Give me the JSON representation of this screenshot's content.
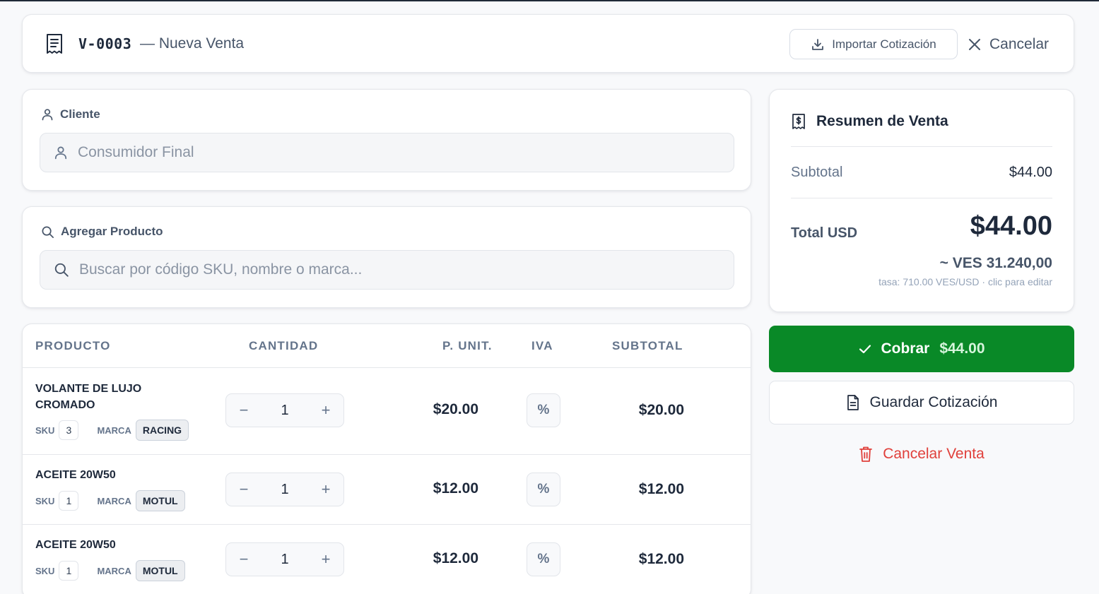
{
  "header": {
    "code": "V-0003",
    "subtitle": "— Nueva Venta",
    "import_label": "Importar Cotización",
    "cancel_label": "Cancelar"
  },
  "cliente": {
    "label": "Cliente",
    "value": "Consumidor Final"
  },
  "producto": {
    "label": "Agregar Producto",
    "placeholder": "Buscar por código SKU, nombre o marca..."
  },
  "table": {
    "columns": [
      "PRODUCTO",
      "CANTIDAD",
      "P. UNIT.",
      "IVA",
      "SUBTOTAL"
    ],
    "sku_label": "SKU",
    "marca_label": "MARCA",
    "iva_symbol": "%",
    "minus": "−",
    "plus": "+",
    "rows": [
      {
        "name": "VOLANTE DE LUJO CROMADO",
        "sku": "3",
        "marca": "RACING",
        "qty": "1",
        "unit": "$20.00",
        "subtotal": "$20.00"
      },
      {
        "name": "ACEITE 20W50",
        "sku": "1",
        "marca": "MOTUL",
        "qty": "1",
        "unit": "$12.00",
        "subtotal": "$12.00"
      },
      {
        "name": "ACEITE 20W50",
        "sku": "1",
        "marca": "MOTUL",
        "qty": "1",
        "unit": "$12.00",
        "subtotal": "$12.00"
      }
    ]
  },
  "summary": {
    "title": "Resumen de Venta",
    "subtotal_label": "Subtotal",
    "subtotal_value": "$44.00",
    "total_label": "Total USD",
    "total_value": "$44.00",
    "ves_value": "~ VES 31.240,00",
    "rate_note": "tasa: 710.00 VES/USD · clic para editar"
  },
  "actions": {
    "cobrar_label": "Cobrar",
    "cobrar_amount": "$44.00",
    "guardar_label": "Guardar Cotización",
    "cancelar_venta_label": "Cancelar Venta"
  },
  "colors": {
    "accent_green": "#098927",
    "danger_red": "#e0403b",
    "text_dark": "#1e293b",
    "text_muted": "#64748b"
  },
  "icons": [
    "receipt-icon",
    "download-icon",
    "close-icon",
    "user-icon",
    "search-icon",
    "invoice-dollar-icon",
    "check-icon",
    "document-icon",
    "trash-icon"
  ]
}
